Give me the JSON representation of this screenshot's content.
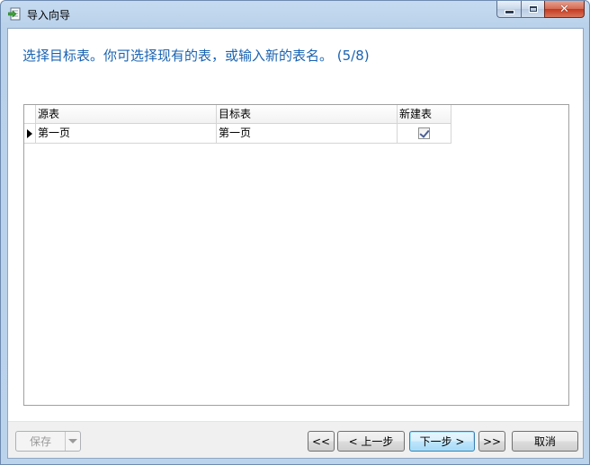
{
  "window": {
    "title": "导入向导",
    "icon": "import-wizard-icon"
  },
  "heading": "选择目标表。你可选择现有的表，或输入新的表名。 (5/8)",
  "grid": {
    "columns": [
      "源表",
      "目标表",
      "新建表"
    ],
    "rows": [
      {
        "source": "第一页",
        "target": "第一页",
        "new_table": true
      }
    ]
  },
  "footer": {
    "save_label": "保存",
    "first_label": "<<",
    "back_label": "< 上一步",
    "next_label": "下一步 >",
    "last_label": ">>",
    "cancel_label": "取消"
  }
}
